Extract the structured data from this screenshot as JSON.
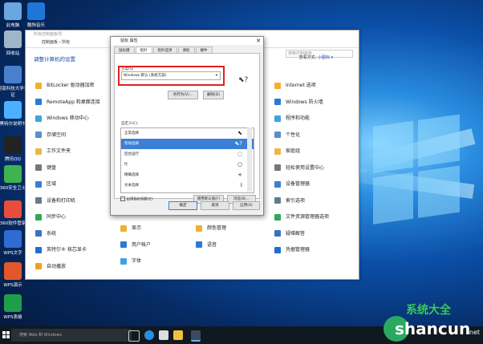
{
  "desktop_icons": [
    {
      "label": "此电脑",
      "icon": "computer-icon",
      "color": "#6aa6e0"
    },
    {
      "label": "酷狗音乐",
      "icon": "kugou-icon",
      "color": "#1e76d8"
    },
    {
      "label": "回收站",
      "icon": "recycle-bin-icon",
      "color": "#9fb5c8"
    },
    {
      "label": "河南科技大学认证",
      "icon": "network-icon",
      "color": "#4a7fd0"
    },
    {
      "label": "黑特尔说明书",
      "icon": "app-icon",
      "color": "#4ab0ff"
    },
    {
      "label": "腾讯QQ",
      "icon": "qq-icon",
      "color": "#222222"
    },
    {
      "label": "360安全卫士",
      "icon": "360-safe-icon",
      "color": "#3fb34f"
    },
    {
      "label": "360软件管家",
      "icon": "360-soft-icon",
      "color": "#e84d3b"
    },
    {
      "label": "WPS文字",
      "icon": "wps-writer-icon",
      "color": "#2f6bd0"
    },
    {
      "label": "WPS演示",
      "icon": "wps-presentation-icon",
      "color": "#e0572c"
    },
    {
      "label": "WPS表格",
      "icon": "wps-spreadsheet-icon",
      "color": "#1f9e4a"
    }
  ],
  "control_panel": {
    "window_title": "所有控制面板项",
    "breadcrumb": "控制面板 › 所有",
    "heading": "调整计算机的设置",
    "view_by": "查看方式:",
    "view_mode": "小图标 ▾",
    "search_placeholder": "搜索控制面板",
    "left_items": [
      "BitLocker 驱动器加密",
      "RemoteApp 和桌面连接",
      "Windows 移动中心",
      "存储空间",
      "工作文件夹",
      "键盘",
      "区域",
      "设备和打印机",
      "同步中心",
      "系统",
      "英特尔® 核芯显卡",
      "自动播放"
    ],
    "mid_items": [
      "显示",
      "用户帐户",
      "字体"
    ],
    "mid2_items": [
      "颜色管理",
      "语音"
    ],
    "right_items": [
      "Internet 选项",
      "Windows 防火墙",
      "程序和功能",
      "个性化",
      "家庭组",
      "轻松使用设置中心",
      "设备管理器",
      "索引选项",
      "文件资源管理器选项",
      "疑难解答",
      "凭据管理器"
    ],
    "colors": [
      "#f0b030",
      "#2a7ad8",
      "#3fa3e0",
      "#5a8fc8",
      "#e8b84a",
      "#777777",
      "#3a7fd0",
      "#607d8b",
      "#2eaa55",
      "#3a70c8",
      "#1e6fd0",
      "#f0a020"
    ]
  },
  "dialog": {
    "title": "鼠标 属性",
    "close": "✕",
    "tabs": [
      "鼠标键",
      "指针",
      "指针选项",
      "滑轮",
      "硬件"
    ],
    "selected_tab": 1,
    "scheme_label": "方案(S)",
    "scheme_value": "Windows 默认 (系统方案)",
    "save_as": "另存为(V)...",
    "delete": "删除(D)",
    "customize_label": "自定义(C):",
    "rows": [
      {
        "label": "正常选择",
        "cursor": "⬉"
      },
      {
        "label": "帮助选择",
        "cursor": "⬉?"
      },
      {
        "label": "后台运行",
        "cursor": "◌"
      },
      {
        "label": "忙",
        "cursor": "○"
      },
      {
        "label": "精确选择",
        "cursor": "+"
      },
      {
        "label": "文本选择",
        "cursor": "I"
      }
    ],
    "selected_row": 1,
    "shadow_check": "启用指针阴影(E)",
    "use_default": "使用默认值(F)",
    "browse": "浏览(B)...",
    "ok": "确定",
    "cancel": "取消",
    "apply": "应用(A)"
  },
  "taskbar": {
    "search_text": "搜索 Web 和 Windows"
  },
  "watermark": {
    "top": "系统大全",
    "bottom": "shancun",
    "suffix": ".net"
  }
}
